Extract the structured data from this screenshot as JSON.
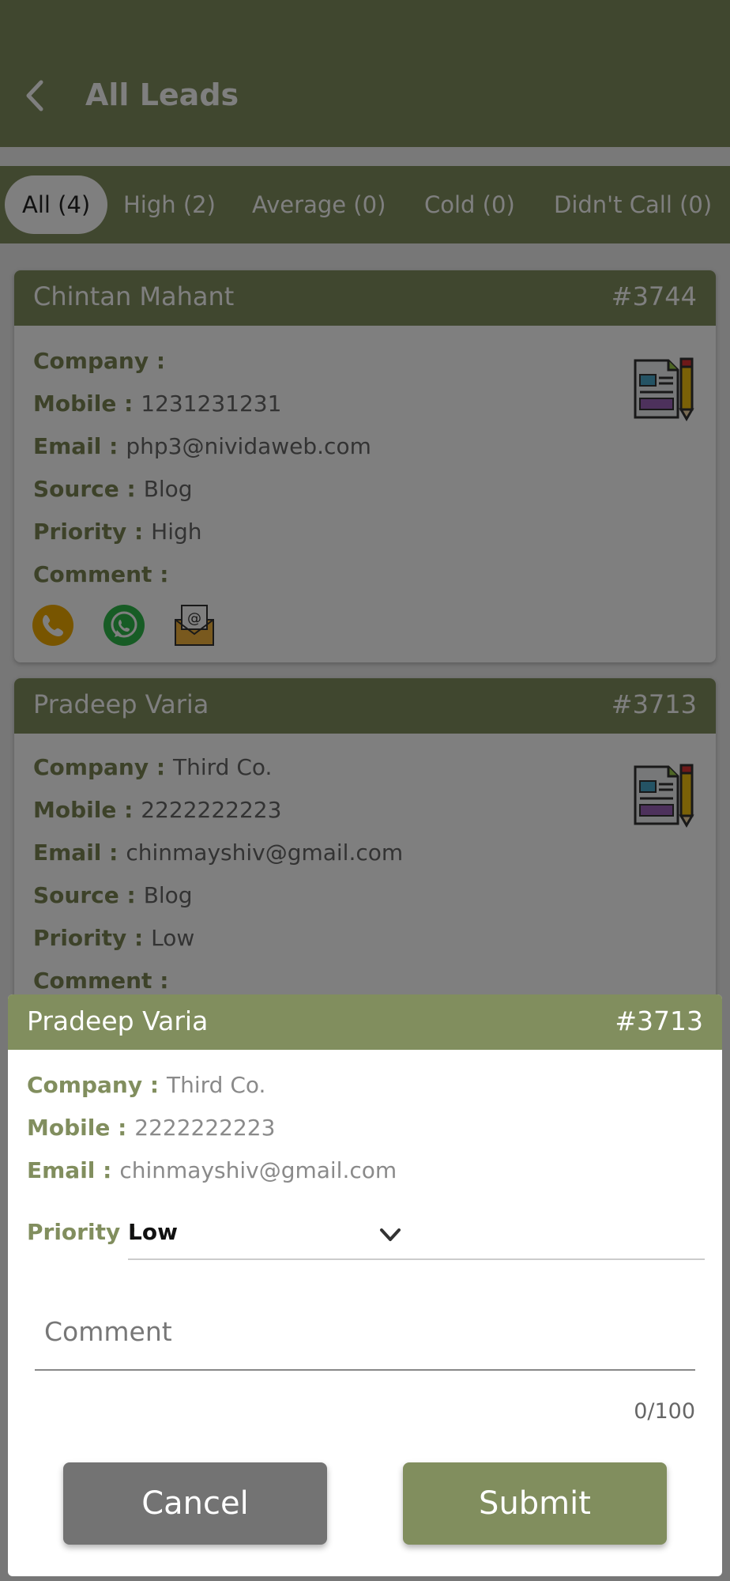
{
  "colors": {
    "primary": "#818e5e",
    "cancel": "#737373"
  },
  "appbar": {
    "title": "All Leads",
    "back_icon": "back-arrow-icon"
  },
  "tabs": [
    {
      "label": "All (4)",
      "active": true
    },
    {
      "label": "High (2)",
      "active": false
    },
    {
      "label": "Average (0)",
      "active": false
    },
    {
      "label": "Cold (0)",
      "active": false
    },
    {
      "label": "Didn't Call (0)",
      "active": false
    }
  ],
  "leads": [
    {
      "name": "Chintan Mahant",
      "id": "#3744",
      "fields": [
        {
          "label": "Company :",
          "value": ""
        },
        {
          "label": "Mobile :",
          "value": "1231231231"
        },
        {
          "label": "Email :",
          "value": "php3@nividaweb.com"
        },
        {
          "label": "Source :",
          "value": "Blog"
        },
        {
          "label": "Priority :",
          "value": "High"
        },
        {
          "label": "Comment :",
          "value": ""
        }
      ],
      "actions": [
        "phone-icon",
        "whatsapp-icon",
        "email-icon"
      ]
    },
    {
      "name": "Pradeep Varia",
      "id": "#3713",
      "fields": [
        {
          "label": "Company :",
          "value": "Third Co."
        },
        {
          "label": "Mobile :",
          "value": "2222222223"
        },
        {
          "label": "Email :",
          "value": "chinmayshiv@gmail.com"
        },
        {
          "label": "Source :",
          "value": "Blog"
        },
        {
          "label": "Priority :",
          "value": "Low"
        },
        {
          "label": "Comment :",
          "value": ""
        }
      ]
    }
  ],
  "sheet": {
    "name": "Pradeep Varia",
    "id": "#3713",
    "company_label": "Company :",
    "company_value": "Third Co.",
    "mobile_label": "Mobile :",
    "mobile_value": "2222222223",
    "email_label": "Email :",
    "email_value": "chinmayshiv@gmail.com",
    "priority_label": "Priority :",
    "priority_value": "Low",
    "comment_placeholder": "Comment",
    "comment_value": "",
    "counter": "0/100",
    "cancel_label": "Cancel",
    "submit_label": "Submit"
  }
}
